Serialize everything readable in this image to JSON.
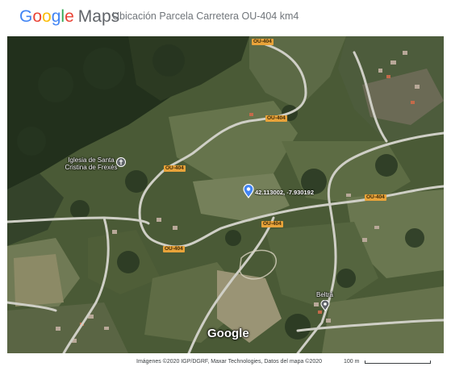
{
  "header": {
    "logo_letters": [
      "G",
      "o",
      "o",
      "g",
      "l",
      "e"
    ],
    "logo_product": "Maps",
    "title": "Ubicación Parcela Carretera OU-404 km4"
  },
  "map": {
    "type": "satellite",
    "road_labels": {
      "top": "OU-404",
      "upper_mid": "OU-404",
      "church_side": "OU-404",
      "right": "OU-404",
      "center": "OU-404",
      "lower_left": "OU-404"
    },
    "places": {
      "church": "Iglesia de Santa Cristina de Frexés",
      "village": "Beltrá"
    },
    "marker": {
      "coordinates": "42.113002, -7.930192",
      "color": "#4285F4"
    },
    "watermark": "Google"
  },
  "footer": {
    "attribution": "Imágenes ©2020 IGP/DGRF, Maxar Technologies, Datos del mapa ©2020",
    "scale": "100 m"
  }
}
